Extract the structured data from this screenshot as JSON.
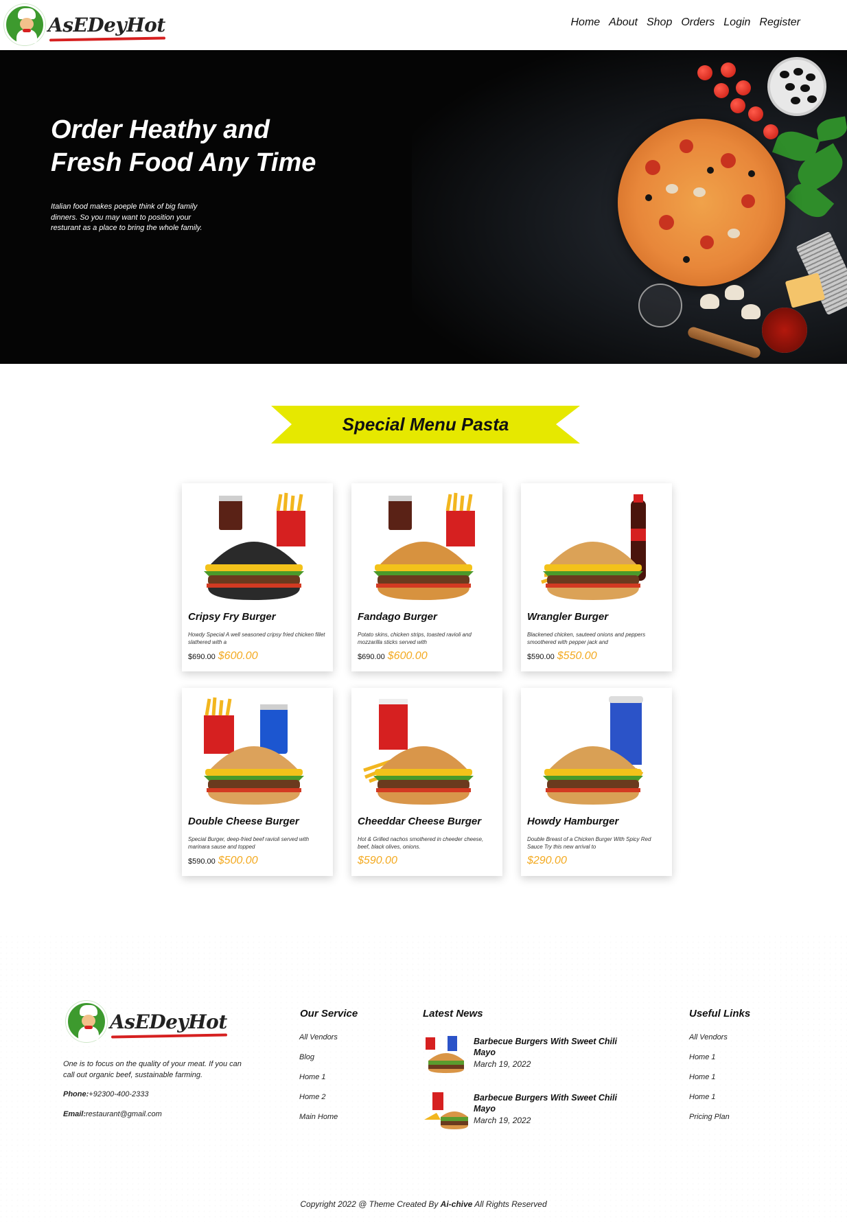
{
  "header": {
    "logo_text": "AsEDeyHot",
    "nav": [
      "Home",
      "About",
      "Shop",
      "Orders",
      "Login",
      "Register"
    ]
  },
  "hero": {
    "title_line1": "Order Heathy and",
    "title_line2": "Fresh Food Any Time",
    "text": "Italian food makes poeple think of big family dinners. So you may want to position your resturant as a place to bring the whole family."
  },
  "section": {
    "title": "Special Menu Pasta",
    "banner_color": "#e6e800"
  },
  "menu": [
    {
      "name": "Cripsy Fry Burger",
      "desc": "Howdy Special A well seasoned cripsy fried chicken fillet slathered with a",
      "old_price": "$690.00",
      "price": "$600.00",
      "drink": "cola",
      "bun": "#2a2a2a"
    },
    {
      "name": "Fandago Burger",
      "desc": "Potato skins, chicken strips, toasted ravioli and mozzarilla sticks served with",
      "old_price": "$690.00",
      "price": "$600.00",
      "drink": "cola",
      "bun": "#d7923f"
    },
    {
      "name": "Wrangler Burger",
      "desc": "Blackened chicken, sauteed onions and peppers smoothered with pepper jack and",
      "old_price": "$590.00",
      "price": "$550.00",
      "drink": "bottle",
      "bun": "#dba257"
    },
    {
      "name": "Double Cheese Burger",
      "desc": "Special Burger, deep-fried beef ravioli served with marinara sause and topped",
      "old_price": "$590.00",
      "price": "$500.00",
      "drink": "can",
      "bun": "#dca25b"
    },
    {
      "name": "Cheeddar Cheese Burger",
      "desc": "Hot & Grilled nachos smothered in cheeder cheese, beef, black olives, onions.",
      "old_price": "",
      "price": "$590.00",
      "drink": "cup-red",
      "bun": "#d9964a"
    },
    {
      "name": "Howdy Hamburger",
      "desc": "Double Breast of a Chicken Burger With Spicy Red Sauce Try this new arrival to",
      "old_price": "",
      "price": "$290.00",
      "drink": "cup-blue",
      "bun": "#d9a055"
    }
  ],
  "footer": {
    "logo_text": "AsEDeyHot",
    "about": "One is to focus on the quality of your meat. If you can call out organic beef, sustainable farming.",
    "phone_label": "Phone:",
    "phone": "+92300-400-2333",
    "email_label": "Email:",
    "email": "restaurant@gmail.com",
    "service_title": "Our Service",
    "service_links": [
      "All Vendors",
      "Blog",
      "Home 1",
      "Home 2",
      "Main Home"
    ],
    "news_title": "Latest News",
    "news": [
      {
        "title": "Barbecue Burgers With Sweet Chili Mayo",
        "date": "March 19, 2022"
      },
      {
        "title": "Barbecue Burgers With Sweet Chili Mayo",
        "date": "March 19, 2022"
      }
    ],
    "useful_title": "Useful Links",
    "useful_links": [
      "All Vendors",
      "Home 1",
      "Home 1",
      "Home 1",
      "Pricing Plan"
    ],
    "copyright_pre": "Copyright 2022 @ Theme Created By",
    "copyright_brand": "Ai-chive",
    "copyright_post": "All Rights Reserved"
  }
}
